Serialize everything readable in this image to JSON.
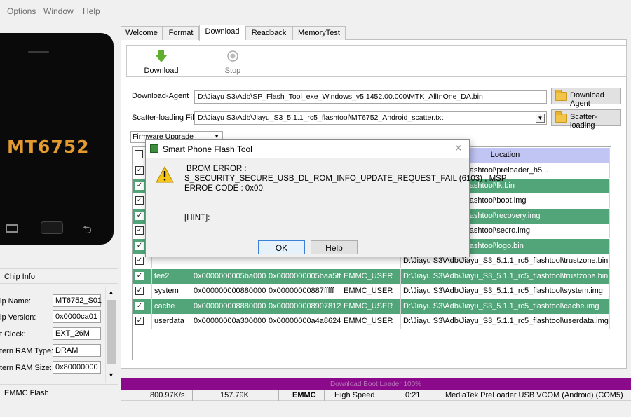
{
  "menu": [
    "Options",
    "Window",
    "Help"
  ],
  "phone": {
    "brand": "MT6752"
  },
  "chip_info": {
    "title": "Chip Info",
    "fields": [
      {
        "label": "ip Name:",
        "value": "MT6752_S01"
      },
      {
        "label": "ip Version:",
        "value": "0x0000ca01"
      },
      {
        "label": "t Clock:",
        "value": "EXT_26M"
      },
      {
        "label": "tern RAM Type:",
        "value": "DRAM"
      },
      {
        "label": "tern RAM Size:",
        "value": "0x80000000"
      }
    ],
    "emmc_label": "EMMC Flash"
  },
  "tabs": [
    "Welcome",
    "Format",
    "Download",
    "Readback",
    "MemoryTest"
  ],
  "active_tab": "Download",
  "toolbar": {
    "download_label": "Download",
    "stop_label": "Stop"
  },
  "download_agent": {
    "label": "Download-Agent",
    "path": "D:\\Jiayu S3\\Adb\\SP_Flash_Tool_exe_Windows_v5.1452.00.000\\MTK_AllInOne_DA.bin",
    "button": "Download Agent"
  },
  "scatter": {
    "label": "Scatter-loading File",
    "path": "D:\\Jiayu S3\\Adb\\Jiayu_S3_5.1.1_rc5_flashtool\\MT6752_Android_scatter.txt",
    "button": "Scatter-loading"
  },
  "mode_select": "Firmware Upgrade",
  "table": {
    "location_header": "Location",
    "rows": [
      {
        "name": "",
        "begin": "",
        "end": "",
        "region": "",
        "location": "yu_S3_5.1.1_rc5_flashtool\\preloader_h5...",
        "green": false
      },
      {
        "name": "",
        "begin": "",
        "end": "",
        "region": "",
        "location": "yu_S3_5.1.1_rc5_flashtool\\lk.bin",
        "green": true
      },
      {
        "name": "",
        "begin": "",
        "end": "",
        "region": "",
        "location": "yu_S3_5.1.1_rc5_flashtool\\boot.img",
        "green": false
      },
      {
        "name": "",
        "begin": "",
        "end": "",
        "region": "",
        "location": "yu_S3_5.1.1_rc5_flashtool\\recovery.img",
        "green": true
      },
      {
        "name": "",
        "begin": "",
        "end": "",
        "region": "",
        "location": "yu_S3_5.1.1_rc5_flashtool\\secro.img",
        "green": false
      },
      {
        "name": "",
        "begin": "",
        "end": "",
        "region": "",
        "location": "yu_S3_5.1.1_rc5_flashtool\\logo.bin",
        "green": true
      },
      {
        "name": "",
        "begin": "",
        "end": "",
        "region": "",
        "location": "D:\\Jiayu S3\\Adb\\Jiayu_S3_5.1.1_rc5_flashtool\\trustzone.bin",
        "green": false
      },
      {
        "name": "tee2",
        "begin": "0x0000000005ba0000",
        "end": "0x0000000005baa5ff",
        "region": "EMMC_USER",
        "location": "D:\\Jiayu S3\\Adb\\Jiayu_S3_5.1.1_rc5_flashtool\\trustzone.bin",
        "green": true
      },
      {
        "name": "system",
        "begin": "0x0000000008800000",
        "end": "0x00000000887fffff",
        "region": "EMMC_USER",
        "location": "D:\\Jiayu S3\\Adb\\Jiayu_S3_5.1.1_rc5_flashtool\\system.img",
        "green": false
      },
      {
        "name": "cache",
        "begin": "0x0000000088800000",
        "end": "0x000000008907812f",
        "region": "EMMC_USER",
        "location": "D:\\Jiayu S3\\Adb\\Jiayu_S3_5.1.1_rc5_flashtool\\cache.img",
        "green": true
      },
      {
        "name": "userdata",
        "begin": "0x00000000a3000000",
        "end": "0x00000000a4a8624f",
        "region": "EMMC_USER",
        "location": "D:\\Jiayu S3\\Adb\\Jiayu_S3_5.1.1_rc5_flashtool\\userdata.img",
        "green": false
      }
    ]
  },
  "progress": {
    "text": "Download Boot Loader 100%",
    "fraction": 1.0,
    "color": "#8b0a8b"
  },
  "status": {
    "speed": "800.97K/s",
    "size": "157.79K",
    "storage": "EMMC",
    "usb_speed": "High Speed",
    "time": "0:21",
    "port": "MediaTek PreLoader USB VCOM (Android) (COM5)"
  },
  "dialog": {
    "title": "Smart Phone Flash Tool",
    "line1": "BROM ERROR :",
    "line2": "S_SECURITY_SECURE_USB_DL_ROM_INFO_UPDATE_REQUEST_FAIL (6103) , MSP",
    "line3": "ERROE CODE : 0x00.",
    "hint": "[HINT]:",
    "ok": "OK",
    "help": "Help"
  },
  "colors": {
    "row_green": "#52a579",
    "header_location": "#c0c5f3",
    "brand": "#e39a2f"
  }
}
